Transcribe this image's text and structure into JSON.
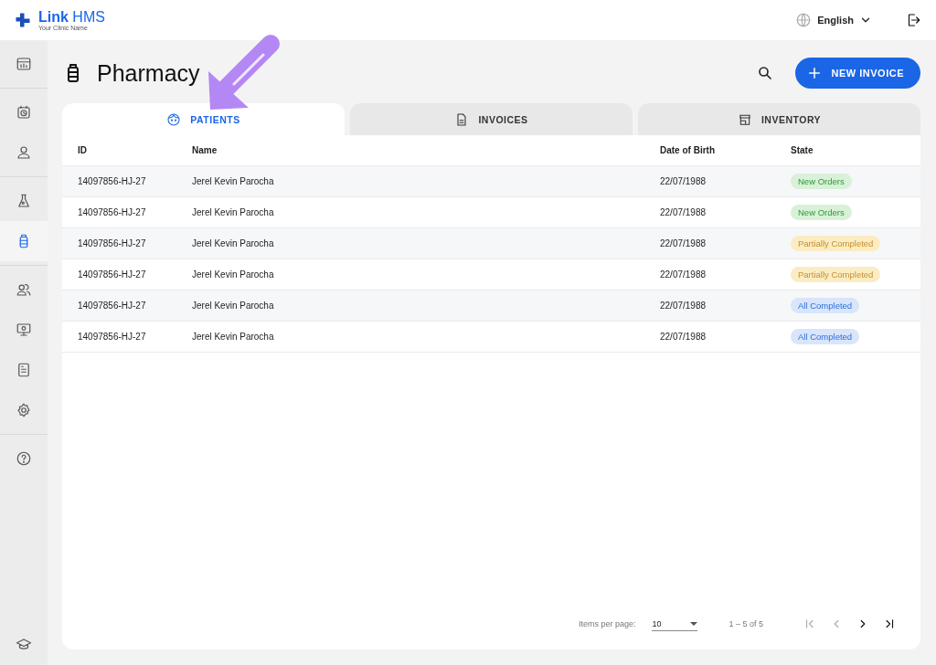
{
  "brand": {
    "name_bold": "Link",
    "name_rest": "HMS",
    "subtitle": "Your Clinic Name"
  },
  "topbar": {
    "language": "English"
  },
  "sidebar": {
    "items": [
      {
        "selected": false
      },
      {
        "selected": false
      },
      {
        "selected": false
      },
      {
        "selected": false
      },
      {
        "selected": true
      },
      {
        "selected": false
      },
      {
        "selected": false
      },
      {
        "selected": false
      },
      {
        "selected": false
      },
      {
        "selected": false
      }
    ]
  },
  "page": {
    "title": "Pharmacy",
    "new_button": "NEW INVOICE"
  },
  "tabs": [
    {
      "label": "PATIENTS",
      "selected": true
    },
    {
      "label": "INVOICES",
      "selected": false
    },
    {
      "label": "INVENTORY",
      "selected": false
    }
  ],
  "table": {
    "columns": [
      "ID",
      "Name",
      "Date of Birth",
      "State"
    ],
    "rows": [
      {
        "id": "14097856-HJ-27",
        "name": "Jerel Kevin Parocha",
        "dob": "22/07/1988",
        "state": "New Orders",
        "kind": "new"
      },
      {
        "id": "14097856-HJ-27",
        "name": "Jerel Kevin Parocha",
        "dob": "22/07/1988",
        "state": "New Orders",
        "kind": "new"
      },
      {
        "id": "14097856-HJ-27",
        "name": "Jerel Kevin Parocha",
        "dob": "22/07/1988",
        "state": "Partially Completed",
        "kind": "partial"
      },
      {
        "id": "14097856-HJ-27",
        "name": "Jerel Kevin Parocha",
        "dob": "22/07/1988",
        "state": "Partially Completed",
        "kind": "partial"
      },
      {
        "id": "14097856-HJ-27",
        "name": "Jerel Kevin Parocha",
        "dob": "22/07/1988",
        "state": "All Completed",
        "kind": "complete"
      },
      {
        "id": "14097856-HJ-27",
        "name": "Jerel Kevin Parocha",
        "dob": "22/07/1988",
        "state": "All Completed",
        "kind": "complete"
      }
    ]
  },
  "pagination": {
    "items_label": "Items per page:",
    "page_size": "10",
    "range": "1 – 5 of 5",
    "first_disabled": true,
    "prev_disabled": true,
    "next_disabled": false,
    "last_disabled": false
  }
}
